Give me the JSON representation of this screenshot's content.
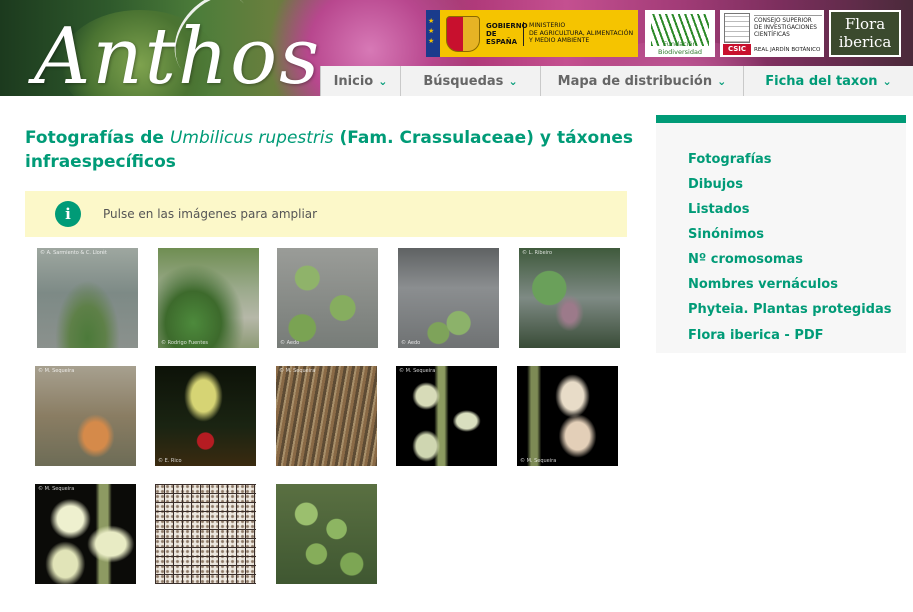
{
  "header": {
    "logo": "Anthos",
    "partners": {
      "gobierno": "GOBIERNO\nDE ESPAÑA",
      "ministerio": "MINISTERIO\nDE AGRICULTURA, ALIMENTACIÓN\nY MEDIO AMBIENTE",
      "fundacion": "Fundación Biodiversidad",
      "csic_label": "CSIC",
      "consejo": "CONSEJO SUPERIOR\nDE INVESTIGACIONES\nCIENTÍFICAS",
      "rjb": "REAL JARDÍN BOTÁNICO",
      "flora_line1": "Flora",
      "flora_line2": "iberica"
    },
    "nav": [
      {
        "label": "Inicio"
      },
      {
        "label": "Búsquedas"
      },
      {
        "label": "Mapa de distribución"
      },
      {
        "label": "Ficha del taxon"
      }
    ]
  },
  "main": {
    "title_prefix": "Fotografías de ",
    "title_species": "Umbilicus rupestris",
    "title_suffix": " (Fam. Crassulaceae) y táxones infraespecíficos",
    "info_text": "Pulse en las imágenes para ampliar",
    "info_icon": "i",
    "photos": [
      {
        "credit": "© A. Sarmiento & C. Llorét"
      },
      {
        "credit": "© Rodrigo Fuentes"
      },
      {
        "credit": "© Aedo"
      },
      {
        "credit": "© Aedo"
      },
      {
        "credit": "© L. Ribeiro"
      },
      {
        "credit": "© M. Sequeira"
      },
      {
        "credit": "© E. Rico"
      },
      {
        "credit": "© M. Sequeira"
      },
      {
        "credit": "© M. Sequeira"
      },
      {
        "credit": "© M. Sequeira"
      },
      {
        "credit": "© M. Sequeira"
      },
      {
        "credit": ""
      },
      {
        "credit": ""
      }
    ]
  },
  "sidebar": {
    "links": [
      {
        "label": "Fotografías"
      },
      {
        "label": "Dibujos"
      },
      {
        "label": "Listados"
      },
      {
        "label": "Sinónimos"
      },
      {
        "label": "Nº cromosomas"
      },
      {
        "label": "Nombres vernáculos"
      },
      {
        "label": "Phyteia. Plantas protegidas"
      },
      {
        "label": "Flora iberica - PDF"
      }
    ]
  },
  "colors": {
    "accent": "#009b77",
    "info_bg": "#fcf8c9"
  }
}
